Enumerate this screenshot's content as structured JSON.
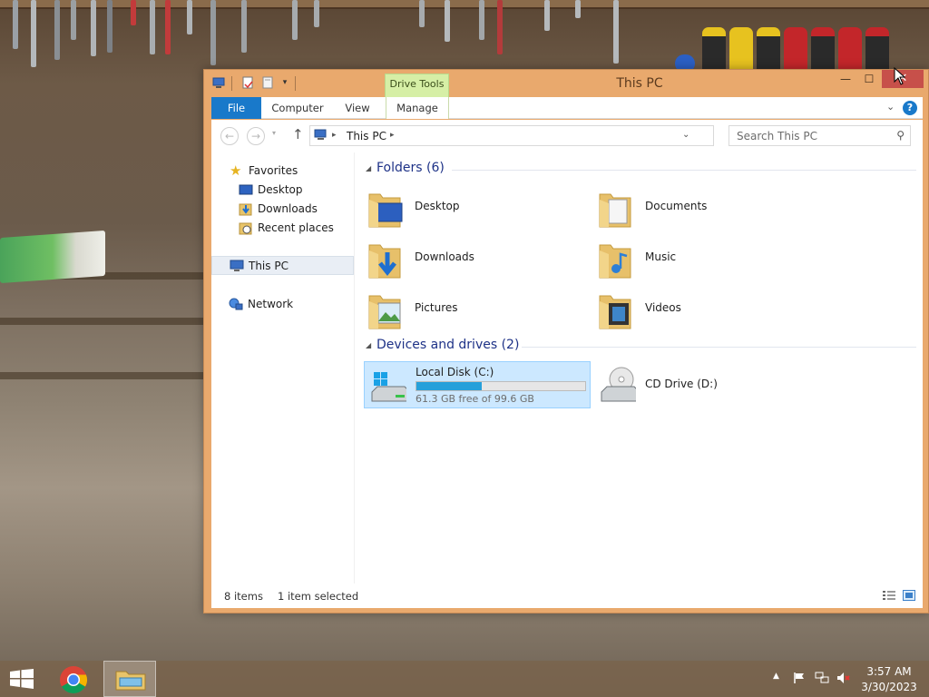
{
  "window": {
    "title": "This PC",
    "contextual_tab_group": "Drive Tools",
    "controls": {
      "minimize": "—",
      "maximize": "☐",
      "close": "✕"
    }
  },
  "ribbon": {
    "tabs": [
      {
        "label": "File"
      },
      {
        "label": "Computer"
      },
      {
        "label": "View"
      },
      {
        "label": "Manage"
      }
    ],
    "help_label": "?"
  },
  "navbar": {
    "back_icon": "back-arrow-icon",
    "forward_icon": "forward-arrow-icon",
    "up_icon": "up-arrow-icon",
    "breadcrumb": [
      "This PC"
    ],
    "search_placeholder": "Search This PC"
  },
  "navpane": {
    "items": [
      {
        "label": "Favorites",
        "icon": "star-icon"
      },
      {
        "label": "Desktop",
        "icon": "desktop-icon"
      },
      {
        "label": "Downloads",
        "icon": "downloads-icon"
      },
      {
        "label": "Recent places",
        "icon": "recent-places-icon"
      },
      {
        "label": "This PC",
        "icon": "this-pc-icon",
        "selected": true
      },
      {
        "label": "Network",
        "icon": "network-icon"
      }
    ]
  },
  "folders_group": {
    "title": "Folders (6)",
    "items": [
      {
        "label": "Desktop",
        "icon": "desktop-folder-icon"
      },
      {
        "label": "Documents",
        "icon": "documents-folder-icon"
      },
      {
        "label": "Downloads",
        "icon": "downloads-folder-icon"
      },
      {
        "label": "Music",
        "icon": "music-folder-icon"
      },
      {
        "label": "Pictures",
        "icon": "pictures-folder-icon"
      },
      {
        "label": "Videos",
        "icon": "videos-folder-icon"
      }
    ]
  },
  "drives_group": {
    "title": "Devices and drives (2)",
    "items": [
      {
        "label": "Local Disk (C:)",
        "free_text": "61.3 GB free of 99.6 GB",
        "used_fraction": 0.385,
        "selected": true
      },
      {
        "label": "CD Drive (D:)"
      }
    ]
  },
  "statusbar": {
    "item_count": "8 items",
    "selection": "1 item selected"
  },
  "taskbar": {
    "time": "3:57 AM",
    "date": "3/30/2023",
    "apps": [
      "start-button",
      "chrome",
      "file-explorer"
    ]
  },
  "colors": {
    "accent": "#1979ca",
    "window_frame": "#e9a96d",
    "drive_tools": "#d6efa6",
    "selection": "#cce8ff",
    "progress": "#26a0da",
    "close_button": "#c7504a"
  }
}
